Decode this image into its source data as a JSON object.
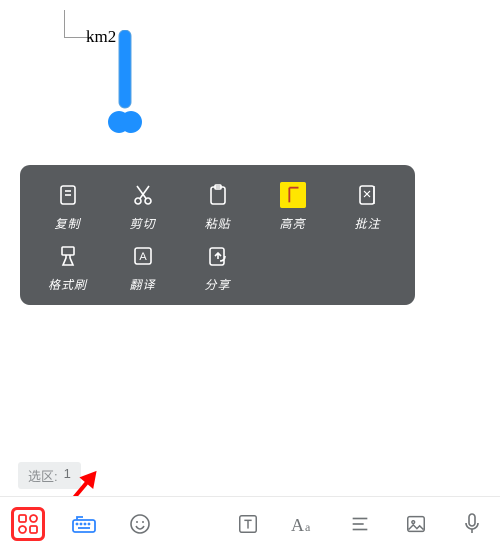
{
  "canvas": {
    "text_label": "km2"
  },
  "context_menu": {
    "row1": [
      {
        "label": "复制",
        "icon": "copy-icon"
      },
      {
        "label": "剪切",
        "icon": "cut-icon"
      },
      {
        "label": "粘贴",
        "icon": "paste-icon"
      },
      {
        "label": "高亮",
        "icon": "highlight-icon"
      },
      {
        "label": "批注",
        "icon": "annotate-icon"
      }
    ],
    "row2": [
      {
        "label": "格式刷",
        "icon": "format-brush-icon"
      },
      {
        "label": "翻译",
        "icon": "translate-icon"
      },
      {
        "label": "分享",
        "icon": "share-icon"
      }
    ]
  },
  "selection": {
    "label": "选区:",
    "count": "1"
  },
  "bottom_bar": {
    "items": [
      {
        "name": "apps-button",
        "icon": "grid-apps-icon"
      },
      {
        "name": "keyboard-button",
        "icon": "keyboard-icon"
      },
      {
        "name": "emoji-button",
        "icon": "emoji-icon"
      },
      {
        "name": "textbox-button",
        "icon": "text-frame-icon"
      },
      {
        "name": "font-button",
        "icon": "font-aa-icon"
      },
      {
        "name": "align-button",
        "icon": "align-lines-icon"
      },
      {
        "name": "image-button",
        "icon": "image-icon"
      },
      {
        "name": "voice-button",
        "icon": "microphone-icon"
      }
    ]
  },
  "colors": {
    "menu_bg": "#585b5e",
    "highlight_yellow": "#ffe600",
    "accent_red": "#ff2a2a",
    "accent_blue": "#2f86ff",
    "thermo_blue": "#1e90ff"
  }
}
